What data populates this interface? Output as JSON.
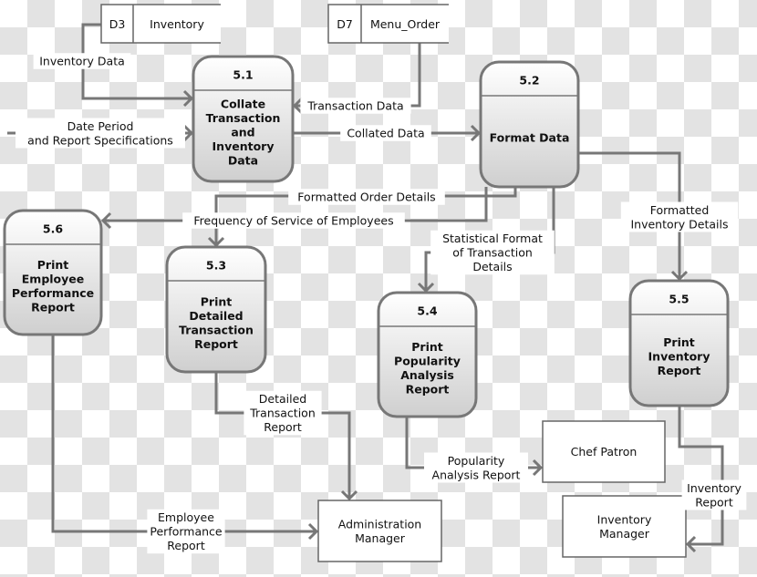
{
  "stores": [
    {
      "id": "D3",
      "name": "Inventory"
    },
    {
      "id": "D7",
      "name": "Menu_Order"
    }
  ],
  "processes": [
    {
      "num": "5.1",
      "lines": [
        "Collate",
        "Transaction",
        "and",
        "Inventory",
        "Data"
      ]
    },
    {
      "num": "5.2",
      "lines": [
        "Format Data"
      ]
    },
    {
      "num": "5.3",
      "lines": [
        "Print",
        "Detailed",
        "Transaction",
        "Report"
      ]
    },
    {
      "num": "5.4",
      "lines": [
        "Print",
        "Popularity",
        "Analysis",
        "Report"
      ]
    },
    {
      "num": "5.5",
      "lines": [
        "Print",
        "Inventory",
        "Report"
      ]
    },
    {
      "num": "5.6",
      "lines": [
        "Print",
        "Employee",
        "Performance",
        "Report"
      ]
    }
  ],
  "entities": [
    {
      "lines": [
        "Chef Patron"
      ]
    },
    {
      "lines": [
        "Administration",
        "Manager"
      ]
    },
    {
      "lines": [
        "Inventory",
        "Manager"
      ]
    }
  ],
  "flows": {
    "inventory_data": [
      "Inventory Data"
    ],
    "date_period": [
      "Date Period",
      "and Report Specifications"
    ],
    "transaction_data": [
      "Transaction Data"
    ],
    "collated_data": [
      "Collated Data"
    ],
    "formatted_order": [
      "Formatted Order Details"
    ],
    "frequency": [
      "Frequency of Service of Employees"
    ],
    "statistical": [
      "Statistical Format",
      "of  Transaction",
      "Details"
    ],
    "formatted_inventory": [
      "Formatted",
      "Inventory Details"
    ],
    "detailed_transaction": [
      "Detailed",
      "Transaction",
      "Report"
    ],
    "popularity": [
      "Popularity",
      "Analysis Report"
    ],
    "employee_performance": [
      "Employee",
      "Performance",
      "Report"
    ],
    "inventory_report": [
      "Inventory",
      "Report"
    ]
  }
}
